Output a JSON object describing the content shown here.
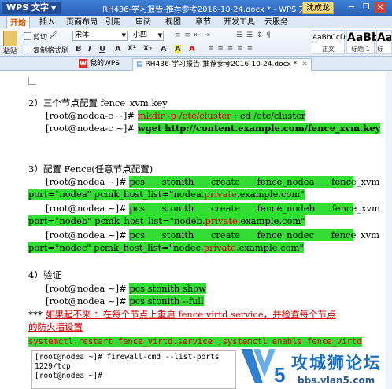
{
  "app": {
    "logo": "WPS 文字",
    "title": "RH436-学习报告-推荐参考2016-10-24.docx * - WPS 文字",
    "user": "沈成龙"
  },
  "ribbon_tabs": [
    "开始",
    "插入",
    "页面布局",
    "引用",
    "审阅",
    "视图",
    "章节",
    "开发工具",
    "云服务"
  ],
  "ribbon": {
    "paste": "粘贴",
    "cut": "剪切",
    "copy": "复制",
    "format_painter": "格式刷",
    "font_name": "宋体",
    "font_size": "小四",
    "format_buttons": [
      "B",
      "I",
      "U",
      "A",
      "X²",
      "X₂",
      "A",
      "A",
      "A"
    ],
    "styles": [
      {
        "sample": "AaBbCcDd",
        "name": "正文"
      },
      {
        "sample": "AaBb",
        "name": "标题 1"
      },
      {
        "sample": "AaBb",
        "name": "标"
      }
    ]
  },
  "doc_tabs": {
    "home": "我的WPS",
    "active": "RH436-学习报告-推荐参考2016-10-24.docx *"
  },
  "document": {
    "section2_title": "2）三个节点配置 fence_xvm.key",
    "s2_l1_prompt": "[root@nodea-c  ~]# ",
    "s2_l1_cmd_a": "mkdir -p /etc/cluster",
    "s2_l1_sep": " ; ",
    "s2_l1_cmd_b": "cd /etc/cluster",
    "s2_l2_prompt": "[root@nodea-c  ~]# ",
    "s2_l2_cmd": "wget http://content.example.com/fence_xvm.key",
    "section3_title": "3）配置 Fence(任意节点配置)",
    "s3_l1_prompt": "[root@nodea  ~]# ",
    "s3_l1_cmd": "pcs  stonith  create  fence_nodea  fence_xvm",
    "s3_l1_cont_a": "port=\"nodea\" pcmk_host_list=\"nodea.",
    "s3_l1_cont_red": "private",
    "s3_l1_cont_b": ".example.com\"",
    "s3_l2_prompt": "[root@nodea  ~]# ",
    "s3_l2_cmd": "pcs  stonith  create  fence_nodeb  fence_xvm",
    "s3_l2_cont_a": "port=\"nodeb\" pcmk_host_list=\"nodeb.",
    "s3_l2_cont_red": "private",
    "s3_l2_cont_b": ".example.com\"",
    "s3_l3_prompt": "[root@nodea  ~]# ",
    "s3_l3_cmd": "pcs  stonith  create  fence_nodec  fence_xvm",
    "s3_l3_cont_a": "port=\"nodec\" pcmk_host_list=\"nodec.",
    "s3_l3_cont_red": "private",
    "s3_l3_cont_b": ".example.com\"",
    "section4_title": "4）验证",
    "s4_l1_prompt": "[root@nodea  ~]# ",
    "s4_l1_cmd": "pcs stonith show",
    "s4_l2_prompt": "[root@nodea  ~]# ",
    "s4_l2_cmd": "pcs stonith --full",
    "note_prefix": "*** ",
    "note_line1": "如果起不来 ：在每个节点上重启 fence virtd.service，并检查每个节点",
    "note_line2": "的防火墙设置",
    "systemctl_line": "systemctl restart fence_virtd.service ;systemctl enable fence_virtd"
  },
  "terminal": {
    "lines": [
      "[root@nodea ~]# firewall-cmd --list-ports",
      "1229/tcp",
      "[root@nodea ~]#"
    ]
  },
  "watermark": {
    "title": "攻城狮论坛",
    "url": "bbs.vlan5.com"
  },
  "colors": {
    "highlight": "#33dd33",
    "red_text": "#d40000",
    "titlebar": "#2a62b6",
    "watermark": "#1b6fc2"
  }
}
